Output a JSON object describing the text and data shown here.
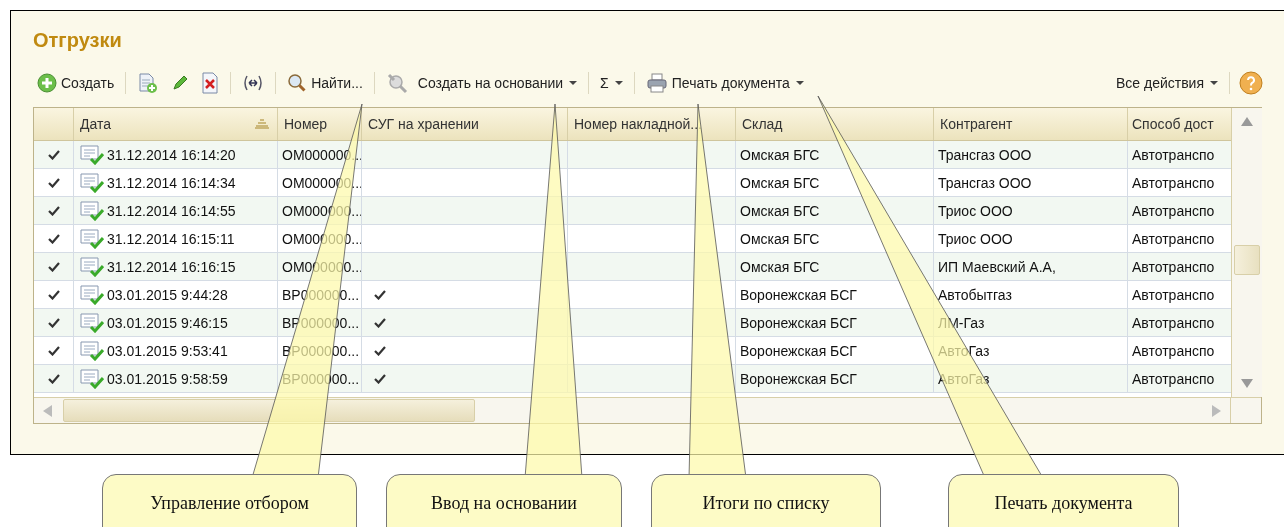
{
  "title": "Отгрузки",
  "toolbar": [
    {
      "items": [
        {
          "kind": "add",
          "label": "Создать"
        }
      ]
    },
    {
      "items": [
        {
          "kind": "copy"
        },
        {
          "kind": "edit"
        },
        {
          "kind": "delete"
        }
      ]
    },
    {
      "items": [
        {
          "kind": "fit"
        }
      ]
    },
    {
      "items": [
        {
          "kind": "find",
          "label": "Найти..."
        }
      ]
    },
    {
      "items": [
        {
          "kind": "based",
          "label": "Создать на основании",
          "dropdown": true
        }
      ]
    },
    {
      "items": [
        {
          "kind": "text",
          "label": "Σ",
          "dropdown": true
        }
      ]
    },
    {
      "items": [
        {
          "kind": "print",
          "label": "Печать документа",
          "dropdown": true
        }
      ]
    }
  ],
  "toolbar_right": [
    {
      "kind": "text",
      "label": "Все действия",
      "dropdown": true
    },
    {
      "kind": "help"
    }
  ],
  "table": {
    "columns": [
      {
        "label": "Дата",
        "sorted": true
      },
      {
        "label": "Номер",
        "sorted": false
      },
      {
        "label": "СУГ на хранении",
        "sorted": false
      },
      {
        "label": "Номер накладной...",
        "sorted": false
      },
      {
        "label": "Склад",
        "sorted": false
      },
      {
        "label": "Контрагент",
        "sorted": false
      },
      {
        "label": "Способ дост",
        "sorted": false
      }
    ],
    "rows": [
      {
        "marked": true,
        "date": "31.12.2014 16:14:20",
        "number": "ОМ000000...",
        "stored": false,
        "warehouse": "Омская БГС",
        "counterparty": "Трансгаз ООО",
        "delivery": "Автотранспо"
      },
      {
        "marked": true,
        "date": "31.12.2014 16:14:34",
        "number": "ОМ000000...",
        "stored": false,
        "warehouse": "Омская БГС",
        "counterparty": "Трансгаз ООО",
        "delivery": "Автотранспо"
      },
      {
        "marked": true,
        "date": "31.12.2014 16:14:55",
        "number": "ОМ000000...",
        "stored": false,
        "warehouse": "Омская БГС",
        "counterparty": "Триос ООО",
        "delivery": "Автотранспо"
      },
      {
        "marked": true,
        "date": "31.12.2014 16:15:11",
        "number": "ОМ000000...",
        "stored": false,
        "warehouse": "Омская БГС",
        "counterparty": "Триос ООО",
        "delivery": "Автотранспо"
      },
      {
        "marked": true,
        "date": "31.12.2014 16:16:15",
        "number": "ОМ000000...",
        "stored": false,
        "warehouse": "Омская БГС",
        "counterparty": "ИП Маевский А.А,",
        "delivery": "Автотранспо"
      },
      {
        "marked": true,
        "date": "03.01.2015 9:44:28",
        "number": "ВР000000...",
        "stored": true,
        "warehouse": "Воронежская БСГ",
        "counterparty": "Автобытгаз",
        "delivery": "Автотранспо"
      },
      {
        "marked": true,
        "date": "03.01.2015 9:46:15",
        "number": "ВР000000...",
        "stored": true,
        "warehouse": "Воронежская БСГ",
        "counterparty": "ЛМ-Газ",
        "delivery": "Автотранспо"
      },
      {
        "marked": true,
        "date": "03.01.2015 9:53:41",
        "number": "ВР000000...",
        "stored": true,
        "warehouse": "Воронежская БСГ",
        "counterparty": "АвтоГаз",
        "delivery": "Автотранспо"
      },
      {
        "marked": true,
        "date": "03.01.2015 9:58:59",
        "number": "ВР000000...",
        "stored": true,
        "warehouse": "Воронежская БСГ",
        "counterparty": "АвтоГаз",
        "delivery": "Автотранспо"
      }
    ]
  },
  "callouts": [
    {
      "label": "Управление отбором"
    },
    {
      "label": "Ввод на основании"
    },
    {
      "label": "Итоги по списку"
    },
    {
      "label": "Печать документа"
    }
  ]
}
